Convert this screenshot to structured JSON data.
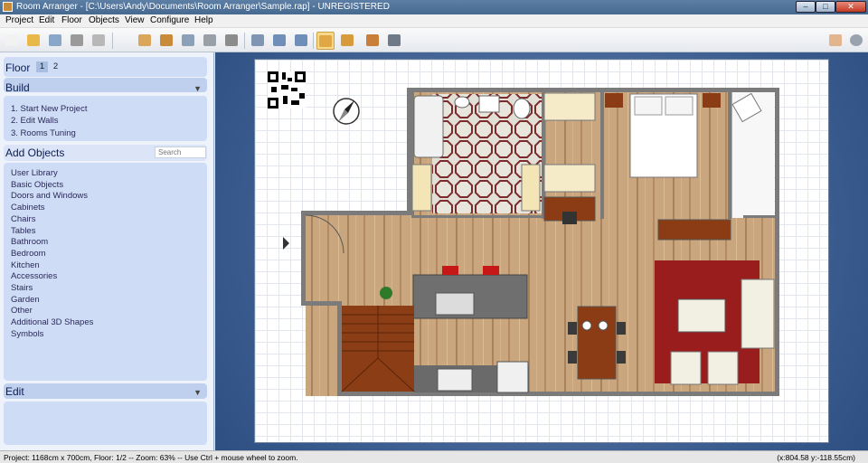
{
  "window": {
    "title": "Room Arranger - [C:\\Users\\Andy\\Documents\\Room Arranger\\Sample.rap] - UNREGISTERED",
    "minimize": "–",
    "maximize": "□",
    "close": "✕"
  },
  "menu": [
    "Project",
    "Edit",
    "Floor",
    "Objects",
    "View",
    "Configure",
    "Help"
  ],
  "toolbar": {
    "buttons": [
      {
        "name": "new-project-icon",
        "color": "#f2f2f2"
      },
      {
        "name": "open-folder-icon",
        "color": "#e8b94a"
      },
      {
        "name": "save-icon",
        "color": "#8aa6c9"
      },
      {
        "name": "print-icon",
        "color": "#9a9a9a"
      },
      {
        "name": "pencil-icon",
        "color": "#b8b8b8"
      },
      {
        "name": "edit-walls-icon",
        "color": "#d9a65a"
      },
      {
        "name": "floor-tile-icon",
        "color": "#c98a3a"
      },
      {
        "name": "resize-icon",
        "color": "#8ca0b8"
      },
      {
        "name": "car-icon",
        "color": "#9aa0a8"
      },
      {
        "name": "bench-icon",
        "color": "#8c8c8c"
      },
      {
        "name": "zoom-fit-icon",
        "color": "#7f95b3"
      },
      {
        "name": "zoom-in-icon",
        "color": "#6f8fb8"
      },
      {
        "name": "zoom-out-icon",
        "color": "#6f8fb8"
      },
      {
        "name": "2d-view-icon",
        "color": "#e1a744"
      },
      {
        "name": "3d-boxes-icon",
        "color": "#d79b3c"
      },
      {
        "name": "3d-house-icon",
        "color": "#c97e3a"
      },
      {
        "name": "rooms-tuning-icon",
        "color": "#6f7a88"
      },
      {
        "name": "hand-pointer-icon",
        "color": "#e3b58f"
      },
      {
        "name": "info-icon",
        "color": "#9aa3ad"
      }
    ]
  },
  "sidebar": {
    "floor": {
      "label": "Floor",
      "levels": [
        "1",
        "2"
      ],
      "active": "1"
    },
    "build": {
      "title": "Build",
      "chevron": "▼",
      "items": [
        "1. Start New Project",
        "2. Edit Walls",
        "3. Rooms Tuning"
      ]
    },
    "add_objects": {
      "title": "Add Objects",
      "search_placeholder": "Search",
      "items": [
        "User Library",
        "Basic Objects",
        "Doors and Windows",
        "Cabinets",
        "Chairs",
        "Tables",
        "Bathroom",
        "Bedroom",
        "Kitchen",
        "Accessories",
        "Stairs",
        "Garden",
        "Other",
        "Additional 3D Shapes",
        "Symbols"
      ]
    },
    "edit": {
      "title": "Edit",
      "chevron": "▼"
    }
  },
  "colors": {
    "wall": "#7b7b7b",
    "floor_wood": "#c9a67e",
    "tile": "#dedbd0",
    "stairs": "#8b3d16",
    "rug": "#9a1d1d",
    "sofa": "#f2f0e3",
    "table": "#8c3c14",
    "counter": "#6f6f6f"
  },
  "status": {
    "left": "Project: 1168cm x 700cm, Floor: 1/2 -- Zoom: 63% -- Use Ctrl + mouse wheel to zoom.",
    "right": "(x:804.58 y:-118.55cm)"
  }
}
